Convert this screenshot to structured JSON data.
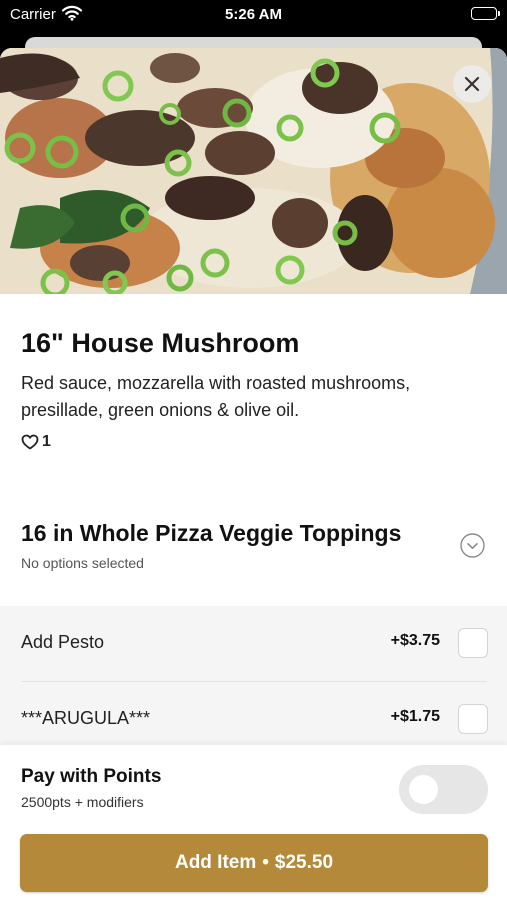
{
  "status_bar": {
    "carrier": "Carrier",
    "time": "5:26 AM"
  },
  "item": {
    "title": "16\" House Mushroom",
    "description": "Red sauce, mozzarella with roasted mushrooms, presillade, green onions & olive oil.",
    "likes_count": "1"
  },
  "modifier_group": {
    "title": "16 in Whole Pizza Veggie Toppings",
    "subtitle": "No options selected",
    "options": [
      {
        "name": "Add Pesto",
        "price": "+$3.75",
        "checked": false
      },
      {
        "name": "***ARUGULA***",
        "price": "+$1.75",
        "checked": false
      }
    ]
  },
  "points": {
    "title": "Pay with Points",
    "subtitle": "2500pts + modifiers",
    "enabled": false
  },
  "add_button": {
    "label": "Add Item",
    "separator": "•",
    "price": "$25.50"
  },
  "icons": {
    "close": "close-icon",
    "heart": "heart-icon",
    "chevron": "chevron-down-icon",
    "wifi": "wifi-icon",
    "battery": "battery-icon"
  },
  "colors": {
    "accent": "#b5893a",
    "options_background": "#f5f5f5",
    "toggle_off": "#e6e6e6"
  }
}
